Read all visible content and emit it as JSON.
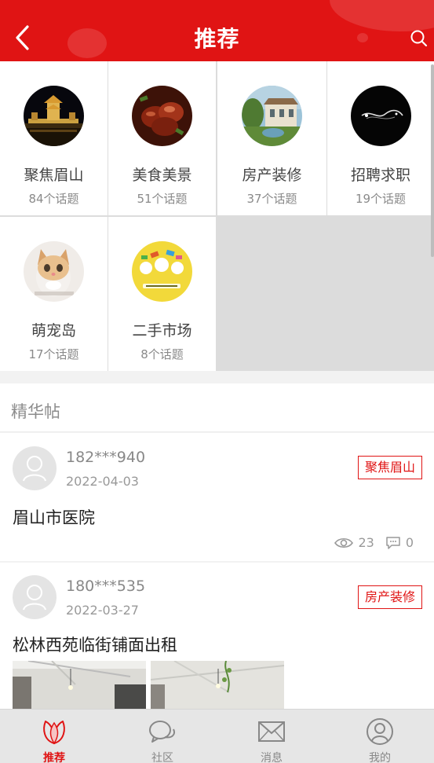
{
  "header": {
    "title": "推荐",
    "back_icon": "chevron-left-icon",
    "search_icon": "search-icon"
  },
  "categories": [
    {
      "name": "聚焦眉山",
      "count": "84个话题",
      "icon": "night-tower-photo"
    },
    {
      "name": "美食美景",
      "count": "51个话题",
      "icon": "braised-pork-photo"
    },
    {
      "name": "房产装修",
      "count": "37个话题",
      "icon": "villa-photo"
    },
    {
      "name": "招聘求职",
      "count": "19个话题",
      "icon": "dark-abstract-photo"
    },
    {
      "name": "萌宠岛",
      "count": "17个话题",
      "icon": "kitten-photo"
    },
    {
      "name": "二手市场",
      "count": "8个话题",
      "icon": "cartoon-market-illustration"
    }
  ],
  "featured": {
    "title": "精华帖",
    "posts": [
      {
        "user": "182***940",
        "date": "2022-04-03",
        "tag": "聚焦眉山",
        "title": "眉山市医院",
        "views": "23",
        "comments": "0"
      },
      {
        "user": "180***535",
        "date": "2022-03-27",
        "tag": "房产装修",
        "title": "松林西苑临街铺面出租"
      }
    ]
  },
  "tabbar": [
    {
      "label": "推荐",
      "icon": "leaf-icon",
      "active": true
    },
    {
      "label": "社区",
      "icon": "chat-bubbles-icon",
      "active": false
    },
    {
      "label": "消息",
      "icon": "envelope-icon",
      "active": false
    },
    {
      "label": "我的",
      "icon": "user-icon",
      "active": false
    }
  ],
  "colors": {
    "brand_red": "#e01414",
    "grid_gap": "#dcdcdc",
    "tab_bg": "#e6e6e6"
  }
}
